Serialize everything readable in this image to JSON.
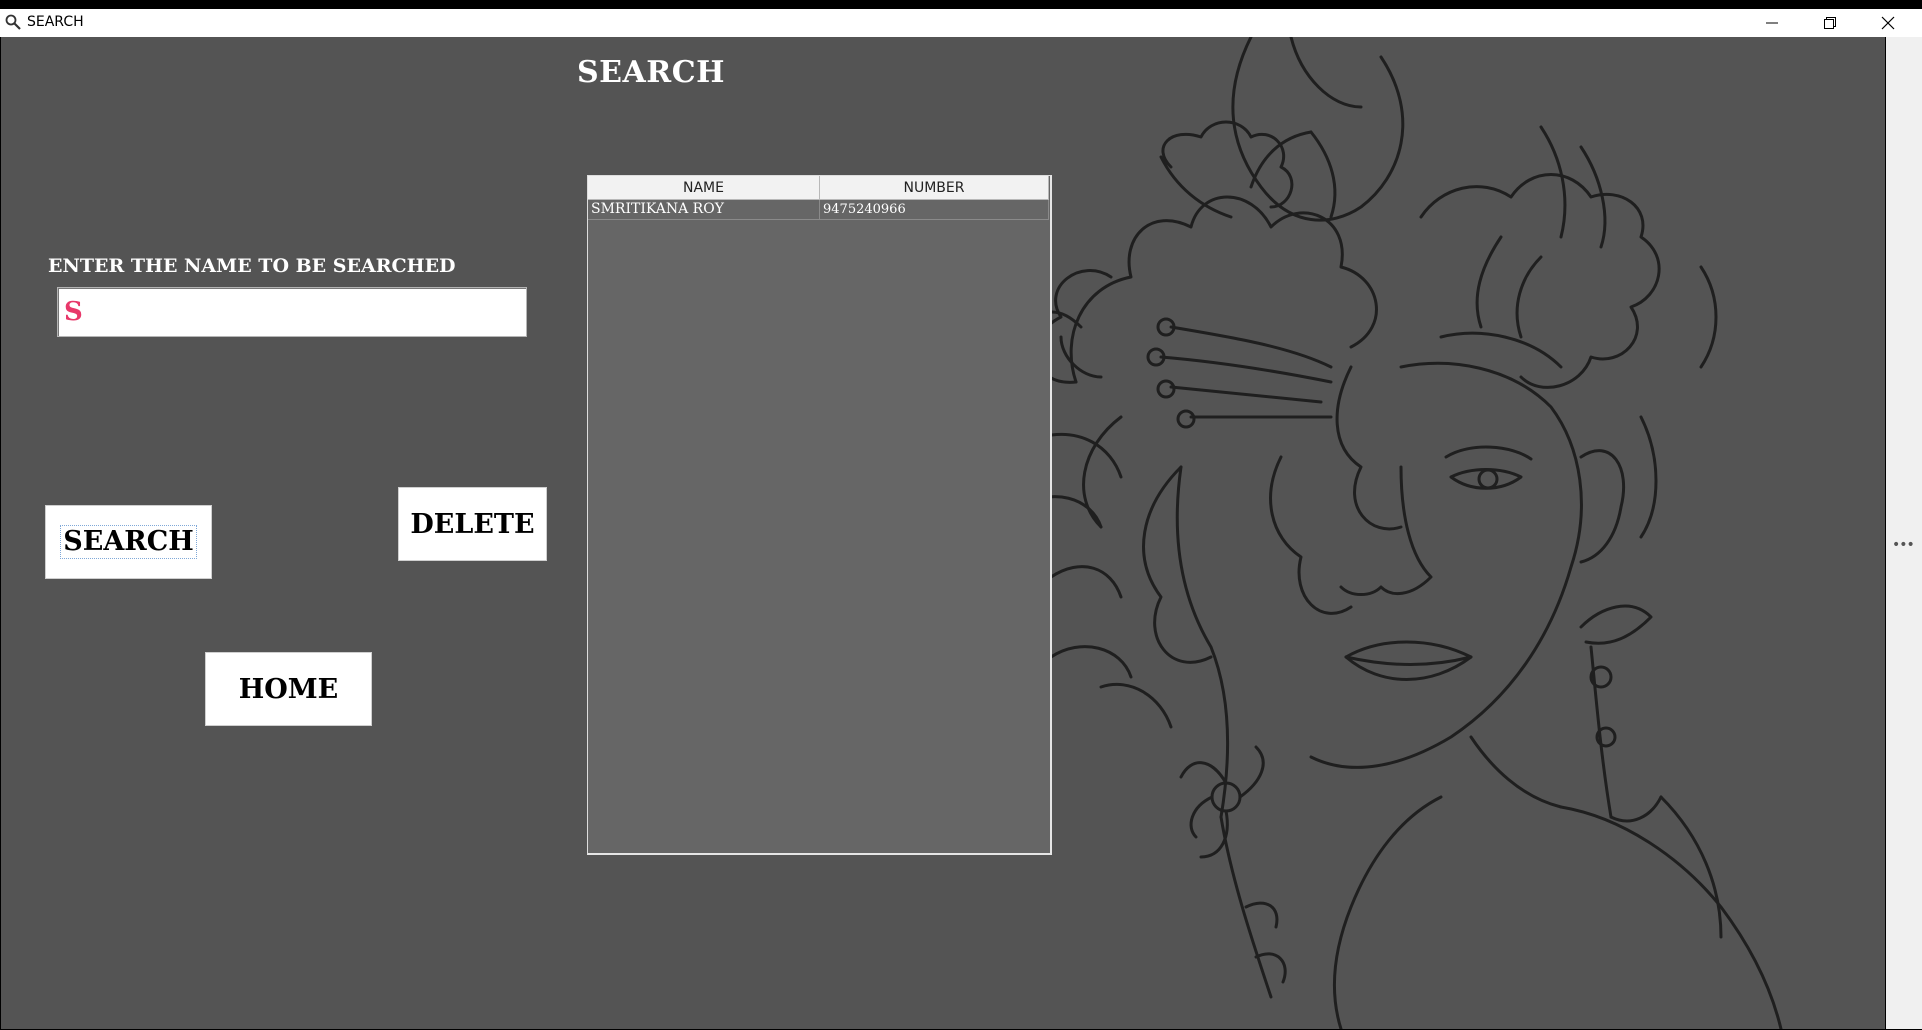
{
  "window": {
    "title": "SEARCH",
    "icons": {
      "app": "search-icon",
      "minimize": "minimize-icon",
      "maximize": "restore-icon",
      "close": "close-icon"
    }
  },
  "page": {
    "title": "SEARCH",
    "search_label": "ENTER THE NAME TO BE SEARCHED",
    "search_value": "S"
  },
  "buttons": {
    "search": "SEARCH",
    "delete": "DELETE",
    "home": "HOME"
  },
  "table": {
    "columns": [
      "NAME",
      "NUMBER"
    ],
    "rows": [
      {
        "name": "SMRITIKANA ROY",
        "number": "9475240966"
      }
    ]
  },
  "colors": {
    "background": "#545454",
    "table_bg": "#666666",
    "input_text": "#e8386a",
    "line_art": "#1f1f1f"
  }
}
